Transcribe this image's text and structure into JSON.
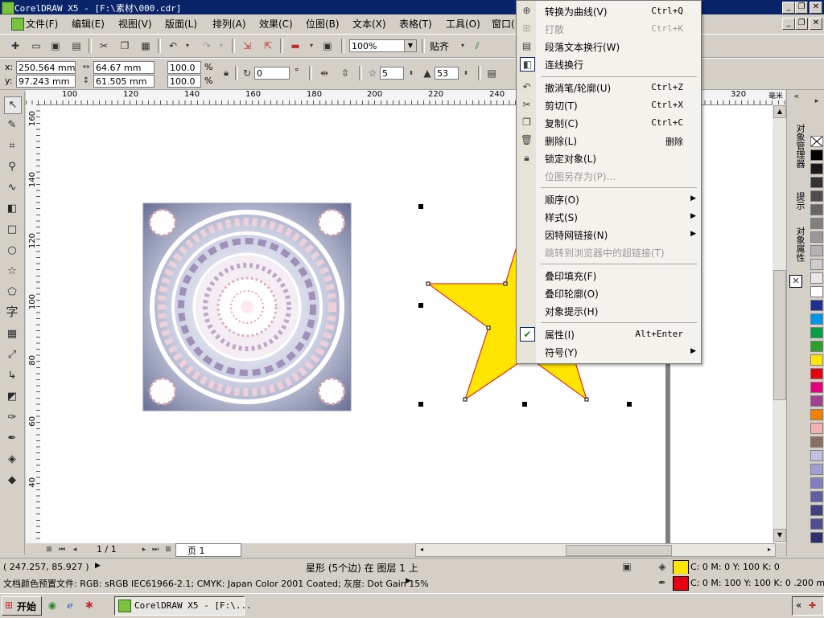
{
  "window": {
    "title": "CorelDRAW X5 - [F:\\素材\\000.cdr]",
    "min": "_",
    "restore": "❐",
    "close": "✕"
  },
  "menubar": {
    "items": [
      "文件(F)",
      "编辑(E)",
      "视图(V)",
      "版面(L)",
      "排列(A)",
      "效果(C)",
      "位图(B)",
      "文本(X)",
      "表格(T)",
      "工具(O)",
      "窗口("
    ]
  },
  "standard_toolbar": {
    "zoom": "100%",
    "snap": "贴齐"
  },
  "property_bar": {
    "x_label": "x:",
    "x": "250.564 mm",
    "y_label": "y:",
    "y": "97.243 mm",
    "w": "64.67 mm",
    "h": "61.505 mm",
    "scale_w": "100.0",
    "scale_h": "100.0",
    "percent": "%",
    "angle": "0",
    "degree": "°",
    "points": "5",
    "sharpness": "53"
  },
  "rulers": {
    "h_ticks": [
      "100",
      "120",
      "140",
      "160",
      "180",
      "200",
      "220",
      "240",
      "320",
      "毫米"
    ],
    "v_ticks": [
      "160",
      "140",
      "120",
      "100",
      "80",
      "60",
      "40"
    ]
  },
  "docker": {
    "tabs": [
      "对象管理器",
      "提示",
      "对象属性"
    ]
  },
  "palette": {
    "colors": [
      "#000000",
      "#1a1a1a",
      "#333333",
      "#4d4d4d",
      "#666666",
      "#808080",
      "#999999",
      "#b3b3b3",
      "#cccccc",
      "#e6e6e6",
      "#ffffff",
      "#1f2f8f",
      "#0096e6",
      "#00a04a",
      "#2ca02c",
      "#ffe500",
      "#e60012",
      "#e6007e",
      "#a0408f",
      "#f08000",
      "#f4b0b0",
      "#8a7060",
      "#c0c0e0",
      "#a0a0d0",
      "#8080c0",
      "#6060a0",
      "#404080",
      "#505090",
      "#303070"
    ]
  },
  "page_nav": {
    "counter": "1 / 1",
    "tab": "页 1"
  },
  "status": {
    "coords": "( 247.257, 85.927 )",
    "object": "星形 (5个边) 在 图层 1 上",
    "fill": "C: 0 M: 0 Y: 100 K: 0",
    "outline": "C: 0 M: 100 Y: 100 K: 0  .200 mm",
    "color_profile": "文档颜色预置文件: RGB: sRGB IEC61966-2.1; CMYK: Japan Color 2001 Coated; 灰度: Dot Gain 15%",
    "fill_color": "#ffe500",
    "outline_color": "#e60012"
  },
  "context_menu": {
    "items": [
      {
        "label": "转换为曲线(V)",
        "shortcut": "Ctrl+Q",
        "disabled": false
      },
      {
        "label": "打散",
        "shortcut": "Ctrl+K",
        "disabled": true
      },
      {
        "label": "段落文本换行(W)",
        "shortcut": "",
        "disabled": false
      },
      {
        "label": "连线换行",
        "shortcut": "",
        "disabled": false
      },
      {
        "label": "撤消笔/轮廓(U)",
        "shortcut": "Ctrl+Z",
        "disabled": false
      },
      {
        "label": "剪切(T)",
        "shortcut": "Ctrl+X",
        "disabled": false
      },
      {
        "label": "复制(C)",
        "shortcut": "Ctrl+C",
        "disabled": false
      },
      {
        "label": "删除(L)",
        "shortcut": "删除",
        "disabled": false
      },
      {
        "label": "锁定对象(L)",
        "shortcut": "",
        "disabled": false
      },
      {
        "label": "位图另存为(P)...",
        "shortcut": "",
        "disabled": true
      },
      {
        "label": "顺序(O)",
        "shortcut": "",
        "disabled": false
      },
      {
        "label": "样式(S)",
        "shortcut": "",
        "disabled": false
      },
      {
        "label": "因特网链接(N)",
        "shortcut": "",
        "disabled": false
      },
      {
        "label": "跳转到浏览器中的超链接(T)",
        "shortcut": "",
        "disabled": true
      },
      {
        "label": "叠印填充(F)",
        "shortcut": "",
        "disabled": false
      },
      {
        "label": "叠印轮廓(O)",
        "shortcut": "",
        "disabled": false
      },
      {
        "label": "对象提示(H)",
        "shortcut": "",
        "disabled": false
      },
      {
        "label": "属性(I)",
        "shortcut": "Alt+Enter",
        "disabled": false
      },
      {
        "label": "符号(Y)",
        "shortcut": "",
        "disabled": false
      }
    ]
  },
  "taskbar": {
    "start": "开始",
    "task": "CorelDRAW X5 - [F:\\...",
    "tray": "«"
  },
  "canvas": {
    "star_fill": "#ffe500",
    "star_outline": "#e60012",
    "mandala_bg": "#7880a0"
  }
}
